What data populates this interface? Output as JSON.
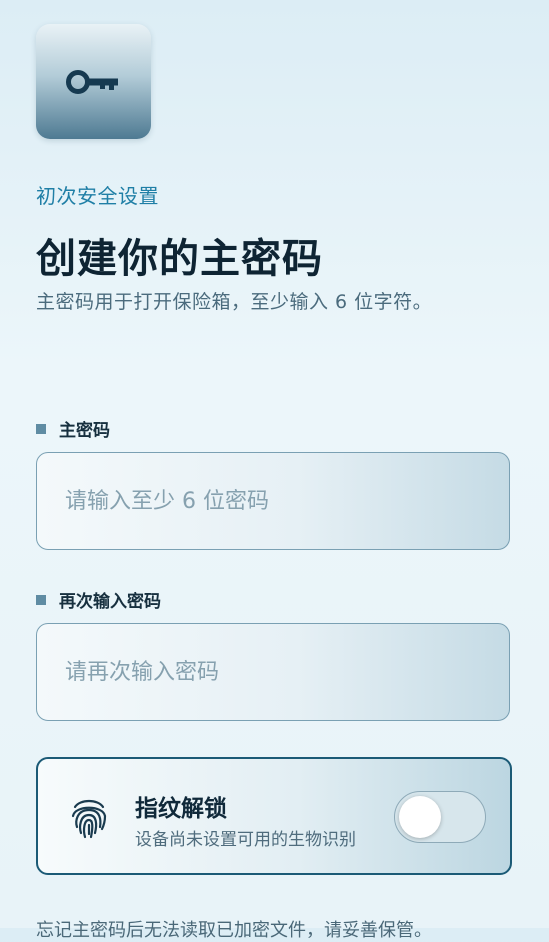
{
  "header": {
    "eyebrow": "初次安全设置",
    "title": "创建你的主密码",
    "subtitle": "主密码用于打开保险箱，至少输入 6 位字符。"
  },
  "fields": {
    "master": {
      "label": "主密码",
      "value": "",
      "placeholder": "请输入至少 6 位密码"
    },
    "confirm": {
      "label": "再次输入密码",
      "value": "",
      "placeholder": "请再次输入密码"
    }
  },
  "biometric": {
    "icon": "fingerprint-icon",
    "title": "指纹解锁",
    "subtitle": "设备尚未设置可用的生物识别",
    "enabled": false
  },
  "app_icon": "key-icon",
  "footer_note": "忘记主密码后无法读取已加密文件，请妥善保管。",
  "colors": {
    "accent": "#1f7fa6",
    "title": "#0e2433",
    "border": "#7aa0b3",
    "card_border": "#1b5a76"
  }
}
